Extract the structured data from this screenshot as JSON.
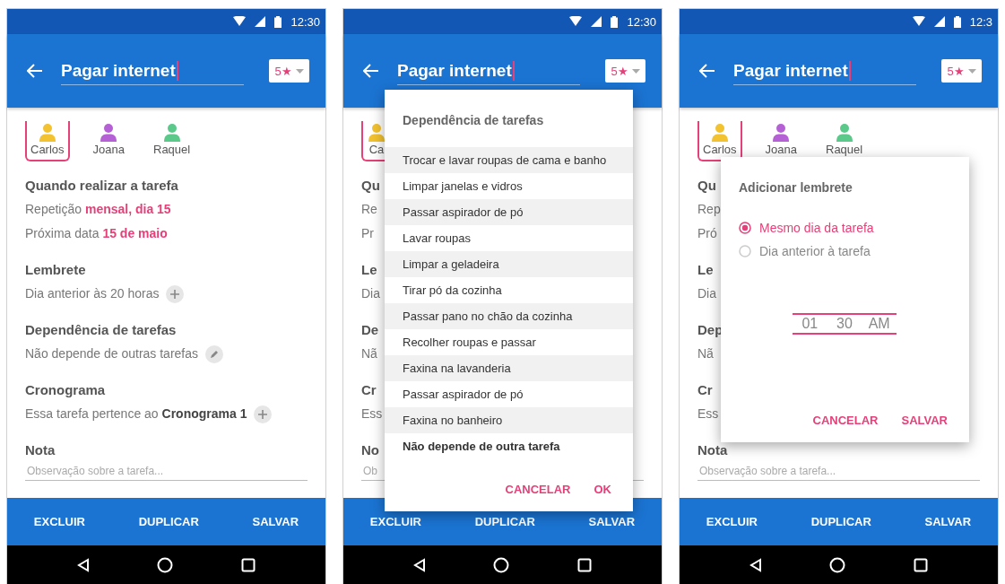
{
  "phones": [
    {
      "status_bar": {
        "time": "12:30"
      },
      "app_bar": {
        "title": "Pagar internet",
        "priority": "5★"
      },
      "assignees": [
        {
          "name": "Carlos",
          "color": "#f2c230",
          "selected": true
        },
        {
          "name": "Joana",
          "color": "#b660d6",
          "selected": false
        },
        {
          "name": "Raquel",
          "color": "#5bc98a",
          "selected": false
        }
      ],
      "sections": [
        {
          "kind": "heading",
          "text": "Quando realizar a tarefa"
        },
        {
          "kind": "line",
          "text": "Repetição **mensal, dia 15**"
        },
        {
          "kind": "line",
          "text": "Próxima data **15 de maio**"
        },
        {
          "kind": "heading",
          "text": "Lembrete"
        },
        {
          "kind": "add",
          "text": "Dia anterior às 20 horas"
        },
        {
          "kind": "heading",
          "text": "Dependência de tarefas"
        },
        {
          "kind": "edit",
          "text": "Não depende de outras tarefas"
        },
        {
          "kind": "heading",
          "text": "Cronograma"
        },
        {
          "kind": "add",
          "text": "Essa tarefa pertence ao **Cronograma 1**"
        },
        {
          "kind": "heading",
          "text": "Nota"
        },
        {
          "kind": "note",
          "placeholder": "Observação sobre a tarefa..."
        }
      ],
      "actions": [
        "EXCLUIR",
        "DUPLICAR",
        "SALVAR"
      ]
    },
    {
      "status_bar": {
        "time": "12:30"
      },
      "app_bar": {
        "title": "Pagar internet",
        "priority": "5★"
      },
      "assignees": [
        {
          "name": "Ca",
          "color": "#f2c230",
          "selected": true
        }
      ],
      "sections": [
        {
          "kind": "heading",
          "text": "Qu"
        },
        {
          "kind": "line",
          "text": "Re"
        },
        {
          "kind": "line",
          "text": "Pr"
        },
        {
          "kind": "heading",
          "text": "Le"
        },
        {
          "kind": "line",
          "text": "Dia"
        },
        {
          "kind": "heading",
          "text": "De"
        },
        {
          "kind": "line",
          "text": "Nã"
        },
        {
          "kind": "heading",
          "text": "Cr"
        },
        {
          "kind": "line",
          "text": "Ess"
        },
        {
          "kind": "heading",
          "text": "No"
        },
        {
          "kind": "note",
          "placeholder": "Ob"
        }
      ],
      "actions": [
        "EXCLUIR",
        "DUPLICAR",
        "SALVAR"
      ],
      "dialog": {
        "kind": "list",
        "title": "Dependência de tarefas",
        "items": [
          {
            "text": "Trocar e lavar roupas de cama e banho",
            "selected": false
          },
          {
            "text": "Limpar janelas e vidros",
            "selected": false
          },
          {
            "text": "Passar aspirador de pó",
            "selected": false
          },
          {
            "text": "Lavar roupas",
            "selected": false
          },
          {
            "text": "Limpar a geladeira",
            "selected": false
          },
          {
            "text": "Tirar pó da cozinha",
            "selected": false
          },
          {
            "text": "Passar pano no chão da cozinha",
            "selected": false
          },
          {
            "text": "Recolher roupas e passar",
            "selected": false
          },
          {
            "text": "Faxina na lavanderia",
            "selected": false
          },
          {
            "text": "Passar aspirador de pó",
            "selected": false
          },
          {
            "text": "Faxina no banheiro",
            "selected": false
          },
          {
            "text": "Não depende de outra tarefa",
            "selected": true
          }
        ],
        "buttons": [
          "CANCELAR",
          "OK"
        ]
      }
    },
    {
      "status_bar": {
        "time": "12:3"
      },
      "app_bar": {
        "title": "Pagar internet",
        "priority": "5★"
      },
      "assignees": [
        {
          "name": "Carlos",
          "color": "#f2c230",
          "selected": true
        },
        {
          "name": "Joana",
          "color": "#b660d6",
          "selected": false
        },
        {
          "name": "Raquel",
          "color": "#5bc98a",
          "selected": false
        }
      ],
      "sections": [
        {
          "kind": "heading",
          "text": "Qu"
        },
        {
          "kind": "line",
          "text": "Rep"
        },
        {
          "kind": "line",
          "text": "Pró"
        },
        {
          "kind": "heading",
          "text": "Le"
        },
        {
          "kind": "line",
          "text": "Dia"
        },
        {
          "kind": "heading",
          "text": "Dep"
        },
        {
          "kind": "line",
          "text": "Nã"
        },
        {
          "kind": "heading",
          "text": "Cr"
        },
        {
          "kind": "line",
          "text": "Ess"
        },
        {
          "kind": "heading",
          "text": "Nota"
        },
        {
          "kind": "note",
          "placeholder": "Observação sobre a tarefa..."
        }
      ],
      "actions": [
        "EXCLUIR",
        "DUPLICAR",
        "SALVAR"
      ],
      "dialog": {
        "kind": "reminder",
        "title": "Adicionar lembrete",
        "options": [
          {
            "label": "Mesmo dia da tarefa",
            "selected": true
          },
          {
            "label": "Dia anterior à tarefa",
            "selected": false
          }
        ],
        "time": {
          "hour": "01",
          "minute": "30",
          "period": "AM"
        },
        "buttons": [
          "CANCELAR",
          "SALVAR"
        ]
      }
    }
  ]
}
